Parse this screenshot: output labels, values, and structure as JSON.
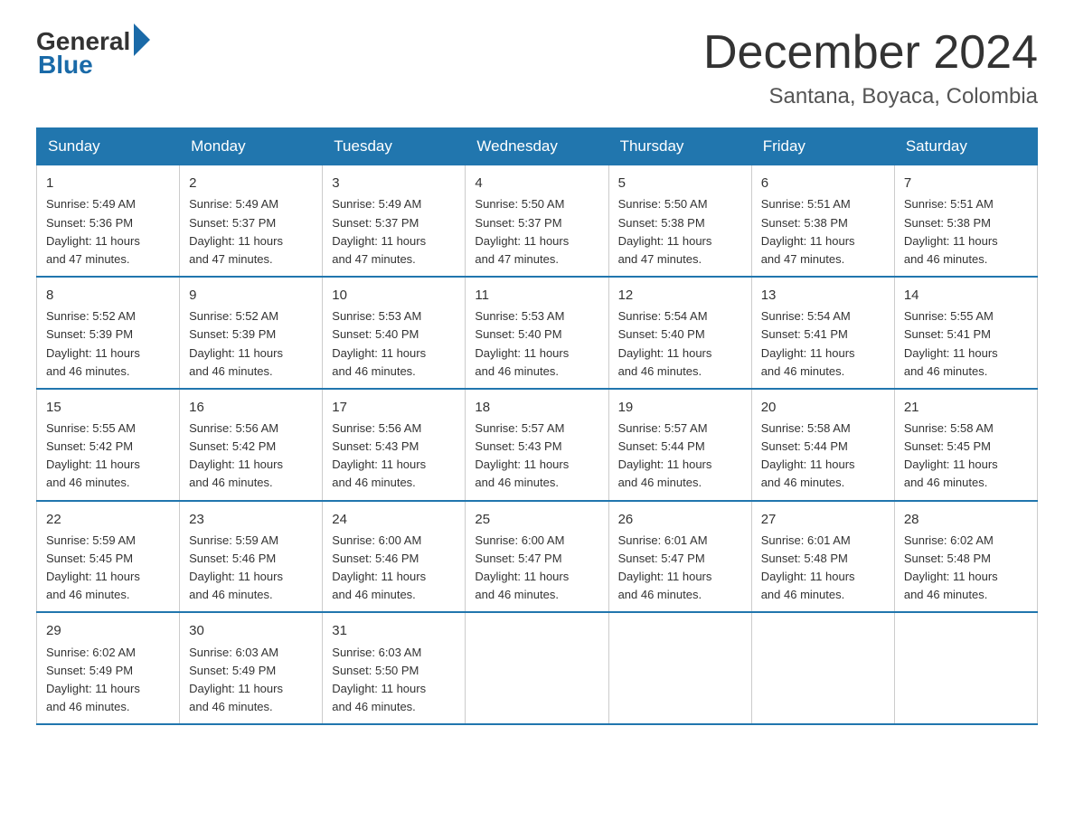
{
  "logo": {
    "general_text": "General",
    "blue_text": "Blue"
  },
  "header": {
    "month_year": "December 2024",
    "location": "Santana, Boyaca, Colombia"
  },
  "days_of_week": [
    "Sunday",
    "Monday",
    "Tuesday",
    "Wednesday",
    "Thursday",
    "Friday",
    "Saturday"
  ],
  "weeks": [
    [
      {
        "day": "1",
        "sunrise": "5:49 AM",
        "sunset": "5:36 PM",
        "daylight": "11 hours and 47 minutes."
      },
      {
        "day": "2",
        "sunrise": "5:49 AM",
        "sunset": "5:37 PM",
        "daylight": "11 hours and 47 minutes."
      },
      {
        "day": "3",
        "sunrise": "5:49 AM",
        "sunset": "5:37 PM",
        "daylight": "11 hours and 47 minutes."
      },
      {
        "day": "4",
        "sunrise": "5:50 AM",
        "sunset": "5:37 PM",
        "daylight": "11 hours and 47 minutes."
      },
      {
        "day": "5",
        "sunrise": "5:50 AM",
        "sunset": "5:38 PM",
        "daylight": "11 hours and 47 minutes."
      },
      {
        "day": "6",
        "sunrise": "5:51 AM",
        "sunset": "5:38 PM",
        "daylight": "11 hours and 47 minutes."
      },
      {
        "day": "7",
        "sunrise": "5:51 AM",
        "sunset": "5:38 PM",
        "daylight": "11 hours and 46 minutes."
      }
    ],
    [
      {
        "day": "8",
        "sunrise": "5:52 AM",
        "sunset": "5:39 PM",
        "daylight": "11 hours and 46 minutes."
      },
      {
        "day": "9",
        "sunrise": "5:52 AM",
        "sunset": "5:39 PM",
        "daylight": "11 hours and 46 minutes."
      },
      {
        "day": "10",
        "sunrise": "5:53 AM",
        "sunset": "5:40 PM",
        "daylight": "11 hours and 46 minutes."
      },
      {
        "day": "11",
        "sunrise": "5:53 AM",
        "sunset": "5:40 PM",
        "daylight": "11 hours and 46 minutes."
      },
      {
        "day": "12",
        "sunrise": "5:54 AM",
        "sunset": "5:40 PM",
        "daylight": "11 hours and 46 minutes."
      },
      {
        "day": "13",
        "sunrise": "5:54 AM",
        "sunset": "5:41 PM",
        "daylight": "11 hours and 46 minutes."
      },
      {
        "day": "14",
        "sunrise": "5:55 AM",
        "sunset": "5:41 PM",
        "daylight": "11 hours and 46 minutes."
      }
    ],
    [
      {
        "day": "15",
        "sunrise": "5:55 AM",
        "sunset": "5:42 PM",
        "daylight": "11 hours and 46 minutes."
      },
      {
        "day": "16",
        "sunrise": "5:56 AM",
        "sunset": "5:42 PM",
        "daylight": "11 hours and 46 minutes."
      },
      {
        "day": "17",
        "sunrise": "5:56 AM",
        "sunset": "5:43 PM",
        "daylight": "11 hours and 46 minutes."
      },
      {
        "day": "18",
        "sunrise": "5:57 AM",
        "sunset": "5:43 PM",
        "daylight": "11 hours and 46 minutes."
      },
      {
        "day": "19",
        "sunrise": "5:57 AM",
        "sunset": "5:44 PM",
        "daylight": "11 hours and 46 minutes."
      },
      {
        "day": "20",
        "sunrise": "5:58 AM",
        "sunset": "5:44 PM",
        "daylight": "11 hours and 46 minutes."
      },
      {
        "day": "21",
        "sunrise": "5:58 AM",
        "sunset": "5:45 PM",
        "daylight": "11 hours and 46 minutes."
      }
    ],
    [
      {
        "day": "22",
        "sunrise": "5:59 AM",
        "sunset": "5:45 PM",
        "daylight": "11 hours and 46 minutes."
      },
      {
        "day": "23",
        "sunrise": "5:59 AM",
        "sunset": "5:46 PM",
        "daylight": "11 hours and 46 minutes."
      },
      {
        "day": "24",
        "sunrise": "6:00 AM",
        "sunset": "5:46 PM",
        "daylight": "11 hours and 46 minutes."
      },
      {
        "day": "25",
        "sunrise": "6:00 AM",
        "sunset": "5:47 PM",
        "daylight": "11 hours and 46 minutes."
      },
      {
        "day": "26",
        "sunrise": "6:01 AM",
        "sunset": "5:47 PM",
        "daylight": "11 hours and 46 minutes."
      },
      {
        "day": "27",
        "sunrise": "6:01 AM",
        "sunset": "5:48 PM",
        "daylight": "11 hours and 46 minutes."
      },
      {
        "day": "28",
        "sunrise": "6:02 AM",
        "sunset": "5:48 PM",
        "daylight": "11 hours and 46 minutes."
      }
    ],
    [
      {
        "day": "29",
        "sunrise": "6:02 AM",
        "sunset": "5:49 PM",
        "daylight": "11 hours and 46 minutes."
      },
      {
        "day": "30",
        "sunrise": "6:03 AM",
        "sunset": "5:49 PM",
        "daylight": "11 hours and 46 minutes."
      },
      {
        "day": "31",
        "sunrise": "6:03 AM",
        "sunset": "5:50 PM",
        "daylight": "11 hours and 46 minutes."
      },
      null,
      null,
      null,
      null
    ]
  ],
  "colors": {
    "header_bg": "#2176ae",
    "header_text": "#ffffff",
    "border": "#cccccc",
    "text": "#333333"
  }
}
